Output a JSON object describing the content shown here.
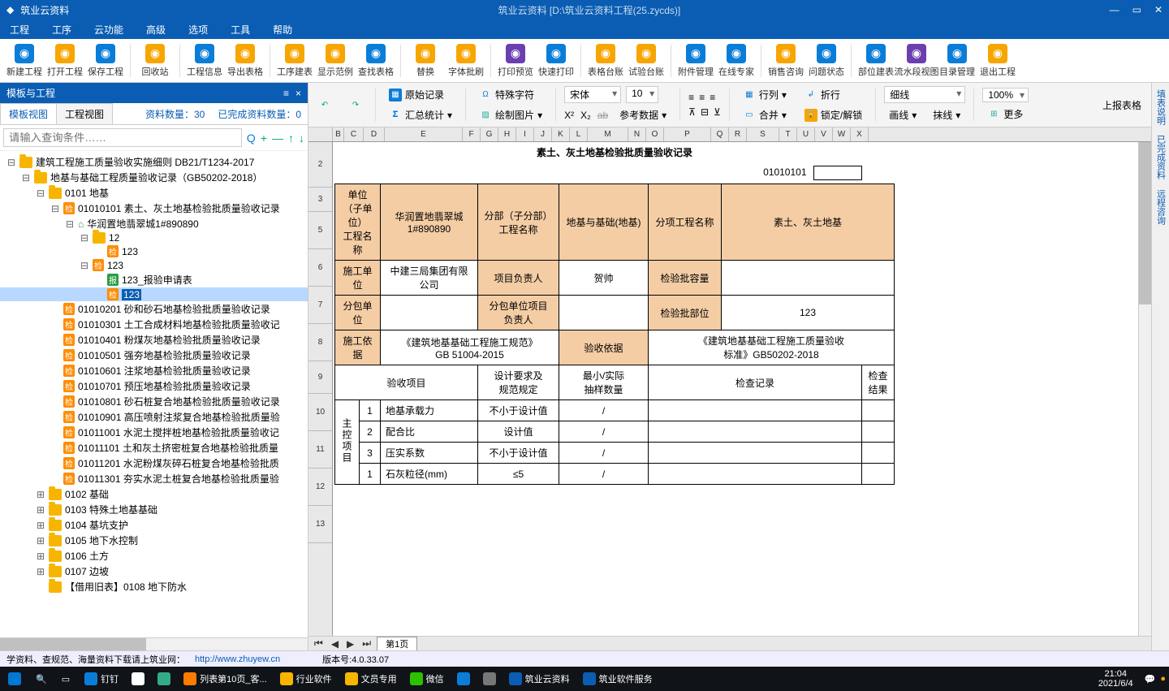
{
  "titlebar": {
    "app": "筑业云资料",
    "doc": "筑业云资料  [D:\\筑业云资料工程(25.zycds)]"
  },
  "menu": [
    "工程",
    "工序",
    "云功能",
    "高级",
    "选项",
    "工具",
    "帮助"
  ],
  "toolbar": [
    {
      "label": "新建工程",
      "color": "#0a7dd8"
    },
    {
      "label": "打开工程",
      "color": "#f7a500"
    },
    {
      "label": "保存工程",
      "color": "#0a7dd8"
    },
    null,
    {
      "label": "回收站",
      "color": "#f7a500"
    },
    null,
    {
      "label": "工程信息",
      "color": "#0a7dd8"
    },
    {
      "label": "导出表格",
      "color": "#f7a500"
    },
    null,
    {
      "label": "工序建表",
      "color": "#f7a500"
    },
    {
      "label": "显示范例",
      "color": "#f7a500"
    },
    {
      "label": "查找表格",
      "color": "#0a7dd8"
    },
    null,
    {
      "label": "替换",
      "color": "#f7a500"
    },
    {
      "label": "字体批刷",
      "color": "#f7a500"
    },
    null,
    {
      "label": "打印预览",
      "color": "#6b3fb0"
    },
    {
      "label": "快速打印",
      "color": "#0a7dd8"
    },
    null,
    {
      "label": "表格台账",
      "color": "#f7a500"
    },
    {
      "label": "试验台账",
      "color": "#f7a500"
    },
    null,
    {
      "label": "附件管理",
      "color": "#0a7dd8"
    },
    {
      "label": "在线专家",
      "color": "#0a7dd8"
    },
    null,
    {
      "label": "销售咨询",
      "color": "#f7a500"
    },
    {
      "label": "问题状态",
      "color": "#0a7dd8"
    },
    null,
    {
      "label": "部位建表",
      "color": "#0a7dd8"
    },
    {
      "label": "流水段视图",
      "color": "#6b3fb0"
    },
    {
      "label": "目录管理",
      "color": "#0a7dd8"
    },
    {
      "label": "退出工程",
      "color": "#f7a500"
    }
  ],
  "left": {
    "header": "模板与工程",
    "tabs": [
      "模板视图",
      "工程视图"
    ],
    "stats": {
      "a": "资料数量：30",
      "b": "已完成资料数量：0"
    },
    "search_placeholder": "请输入查询条件……"
  },
  "tree": [
    {
      "d": 0,
      "exp": "-",
      "ico": "folder",
      "text": "建筑工程施工质量验收实施细则  DB21/T1234-2017"
    },
    {
      "d": 1,
      "exp": "-",
      "ico": "folder",
      "text": "地基与基础工程质量验收记录（GB50202-2018）"
    },
    {
      "d": 2,
      "exp": "-",
      "ico": "folder",
      "text": "0101 地基"
    },
    {
      "d": 3,
      "exp": "-",
      "ico": "jian",
      "text": "01010101 素土、灰土地基检验批质量验收记录"
    },
    {
      "d": 4,
      "exp": "-",
      "ico": "home",
      "text": "华润置地翡翠城1#890890"
    },
    {
      "d": 5,
      "exp": "-",
      "ico": "folder",
      "text": "12"
    },
    {
      "d": 6,
      "exp": "",
      "ico": "jian",
      "text": "123"
    },
    {
      "d": 5,
      "exp": "-",
      "ico": "jian",
      "text": "123"
    },
    {
      "d": 6,
      "exp": "",
      "ico": "bao",
      "text": "123_报验申请表"
    },
    {
      "d": 6,
      "exp": "",
      "ico": "jian",
      "text": "123",
      "sel": true
    },
    {
      "d": 3,
      "exp": "",
      "ico": "jian",
      "text": "01010201 砂和砂石地基检验批质量验收记录"
    },
    {
      "d": 3,
      "exp": "",
      "ico": "jian",
      "text": "01010301 土工合成材料地基检验批质量验收记"
    },
    {
      "d": 3,
      "exp": "",
      "ico": "jian",
      "text": "01010401 粉煤灰地基检验批质量验收记录"
    },
    {
      "d": 3,
      "exp": "",
      "ico": "jian",
      "text": "01010501 强夯地基检验批质量验收记录"
    },
    {
      "d": 3,
      "exp": "",
      "ico": "jian",
      "text": "01010601 注浆地基检验批质量验收记录"
    },
    {
      "d": 3,
      "exp": "",
      "ico": "jian",
      "text": "01010701 预压地基检验批质量验收记录"
    },
    {
      "d": 3,
      "exp": "",
      "ico": "jian",
      "text": "01010801 砂石桩复合地基检验批质量验收记录"
    },
    {
      "d": 3,
      "exp": "",
      "ico": "jian",
      "text": "01010901 高压喷射注浆复合地基检验批质量验"
    },
    {
      "d": 3,
      "exp": "",
      "ico": "jian",
      "text": "01011001 水泥土搅拌桩地基检验批质量验收记"
    },
    {
      "d": 3,
      "exp": "",
      "ico": "jian",
      "text": "01011101 土和灰土挤密桩复合地基检验批质量"
    },
    {
      "d": 3,
      "exp": "",
      "ico": "jian",
      "text": "01011201 水泥粉煤灰碎石桩复合地基检验批质"
    },
    {
      "d": 3,
      "exp": "",
      "ico": "jian",
      "text": "01011301 夯实水泥土桩复合地基检验批质量验"
    },
    {
      "d": 2,
      "exp": "+",
      "ico": "folder",
      "text": "0102 基础"
    },
    {
      "d": 2,
      "exp": "+",
      "ico": "folder",
      "text": "0103 特殊土地基基础"
    },
    {
      "d": 2,
      "exp": "+",
      "ico": "folder",
      "text": "0104 基坑支护"
    },
    {
      "d": 2,
      "exp": "+",
      "ico": "folder",
      "text": "0105 地下水控制"
    },
    {
      "d": 2,
      "exp": "+",
      "ico": "folder",
      "text": "0106 土方"
    },
    {
      "d": 2,
      "exp": "+",
      "ico": "folder",
      "text": "0107 边坡"
    },
    {
      "d": 2,
      "exp": "",
      "ico": "folder",
      "text": "【借用旧表】0108 地下防水"
    }
  ],
  "rp_tools_row1": {
    "orig": "原始记录",
    "spec": "特殊字符",
    "font": "宋体",
    "size": "10",
    "cols": "行列",
    "wrap": "折行",
    "line": "细线",
    "zoom": "100%",
    "submit": "上报表格"
  },
  "rp_tools_row2": {
    "stats": "汇总统计",
    "draw": "绘制图片",
    "refdata": "参考数据",
    "merge": "合并",
    "lock": "锁定/解锁",
    "style1": "画线",
    "style2": "抹线",
    "more": "更多"
  },
  "cols": [
    "",
    "B",
    "C",
    "D",
    "E",
    "F",
    "G",
    "H",
    "I",
    "J",
    "K",
    "L",
    "M",
    "N",
    "O",
    "P",
    "Q",
    "R",
    "S",
    "T",
    "U",
    "V",
    "W",
    "X"
  ],
  "rows": [
    "2",
    "3",
    "5",
    "6",
    "7",
    "8",
    "9",
    "10",
    "11",
    "12",
    "13"
  ],
  "row_heights": {
    "2": 56,
    "3": 30,
    "5": 46,
    "6": 46,
    "7": 46,
    "8": 46,
    "9": 40,
    "10": 46,
    "11": 46,
    "12": 46,
    "13": 46
  },
  "doc": {
    "title": "素土、灰土地基检验批质量验收记录",
    "code": "01010101",
    "r5": {
      "a": "单位（子单位）\n工程名称",
      "b": "华润置地翡翠城\n1#890890",
      "c": "分部（子分部）\n工程名称",
      "d": "地基与基础(地基)",
      "e": "分项工程名称",
      "f": "素土、灰土地基"
    },
    "r6": {
      "a": "施工单位",
      "b": "中建三局集团有限公司",
      "c": "项目负责人",
      "d": "贺帅",
      "e": "检验批容量",
      "f": ""
    },
    "r7": {
      "a": "分包单位",
      "b": "",
      "c": "分包单位项目\n负责人",
      "d": "",
      "e": "检验批部位",
      "f": "123"
    },
    "r8": {
      "a": "施工依据",
      "b": "《建筑地基基础工程施工规范》\nGB 51004-2015",
      "c": "验收依据",
      "d": "《建筑地基基础工程施工质量验收\n标准》GB50202-2018"
    },
    "r9": {
      "a": "验收项目",
      "b": "设计要求及\n规范规定",
      "c": "最小/实际\n抽样数量",
      "d": "检查记录",
      "e": "检查\n结果"
    },
    "side": "主控项目",
    "items": [
      {
        "n": "1",
        "name": "地基承载力",
        "spec": "不小于设计值",
        "samp": "/"
      },
      {
        "n": "2",
        "name": "配合比",
        "spec": "设计值",
        "samp": "/"
      },
      {
        "n": "3",
        "name": "压实系数",
        "spec": "不小于设计值",
        "samp": "/"
      },
      {
        "n": "1",
        "name": "石灰粒径(mm)",
        "spec": "≤5",
        "samp": "/"
      }
    ]
  },
  "sheet_tab": "第1页",
  "sidestrip": [
    "填表说明",
    "已完成资料",
    "远程咨询"
  ],
  "status": {
    "text": "学资料、查规范、海量资料下载请上筑业网：",
    "url": "http://www.zhuyew.cn",
    "ver": "版本号:4.0.33.07"
  },
  "taskbar": {
    "items": [
      {
        "label": "钉钉",
        "color": "#0a7dd8"
      },
      {
        "label": "",
        "color": "#fff"
      },
      {
        "label": "",
        "color": "#3a8"
      },
      {
        "label": "列表第10页_客...",
        "color": "#ff7b00"
      },
      {
        "label": "行业软件",
        "color": "#f7b500"
      },
      {
        "label": "文员专用",
        "color": "#f7b500"
      },
      {
        "label": "微信",
        "color": "#2dc100"
      },
      {
        "label": "",
        "color": "#0a7dd8"
      },
      {
        "label": "",
        "color": "#777"
      },
      {
        "label": "筑业云资料",
        "color": "#0a5db3"
      },
      {
        "label": "筑业软件服务",
        "color": "#0a5db3"
      }
    ],
    "time": "21:04",
    "date": "2021/6/4"
  }
}
